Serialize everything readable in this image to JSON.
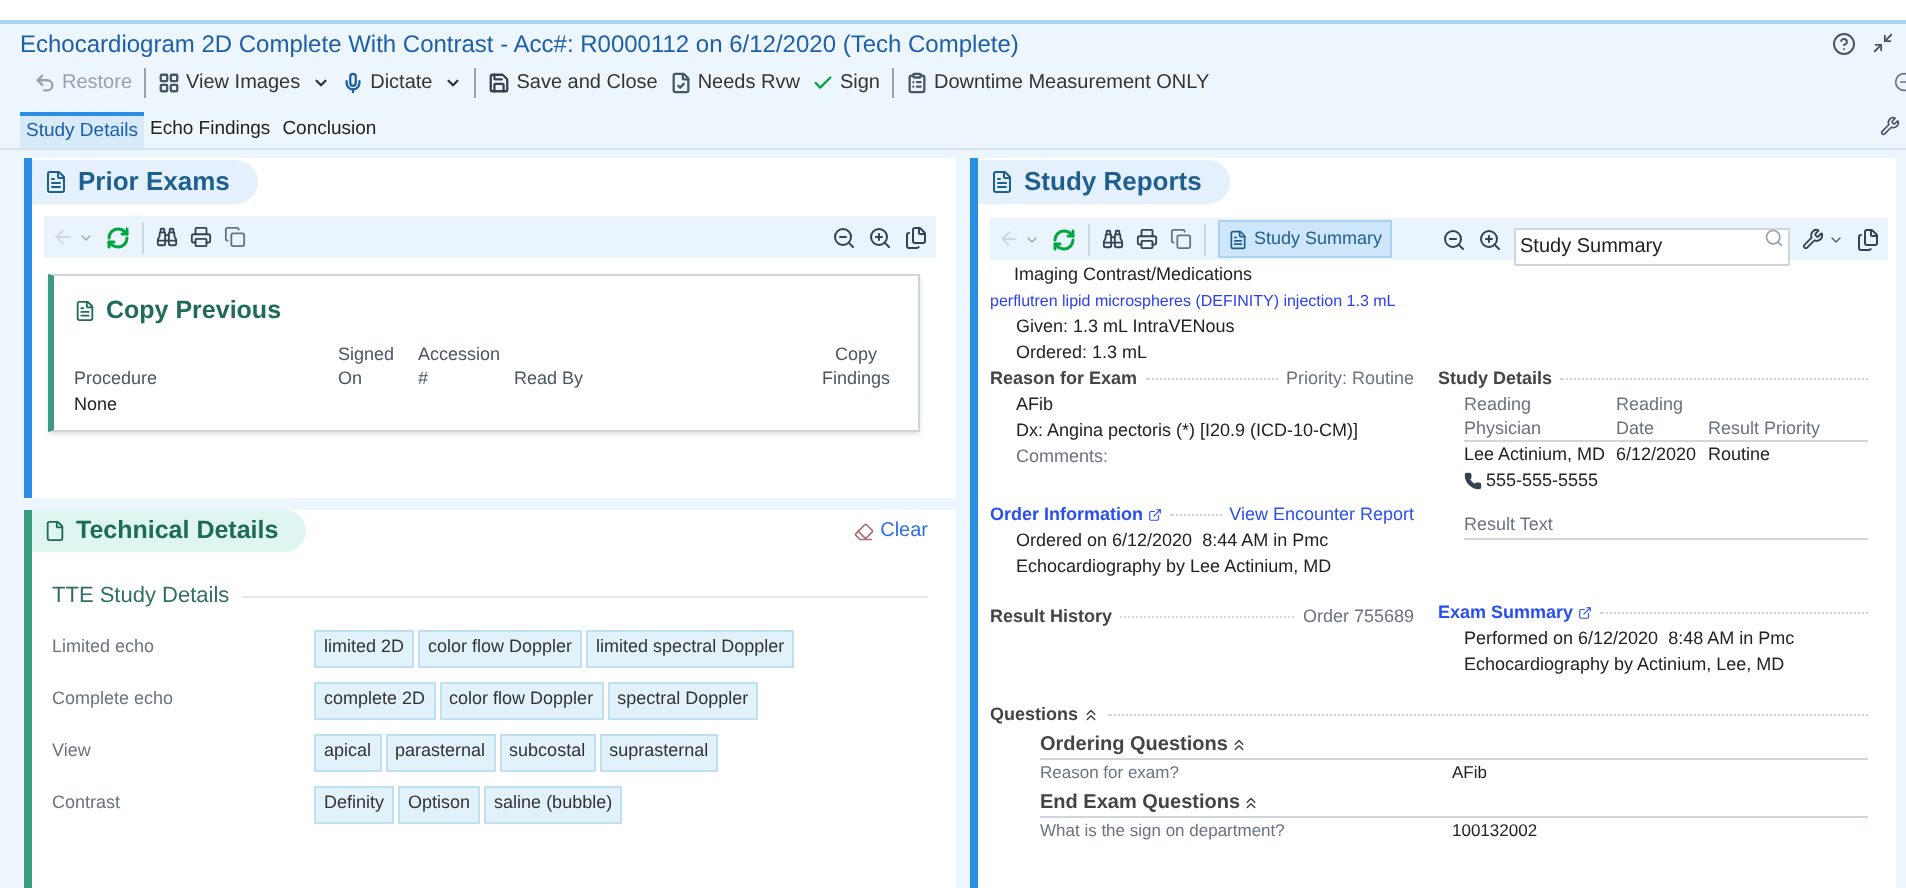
{
  "window": {
    "title": "Echocardiogram 2D Complete With Contrast - Acc#: R0000112 on 6/12/2020 (Tech Complete)"
  },
  "toolbar": [
    {
      "label": "Restore",
      "disabled": true,
      "dropdown": false,
      "separator_after": true
    },
    {
      "label": "View Images",
      "disabled": false,
      "dropdown": true,
      "separator_after": false
    },
    {
      "label": "Dictate",
      "disabled": false,
      "dropdown": true,
      "separator_after": true
    },
    {
      "label": "Save and Close",
      "disabled": false,
      "dropdown": false,
      "separator_after": false
    },
    {
      "label": "Needs Rvw",
      "disabled": false,
      "dropdown": false,
      "separator_after": false
    },
    {
      "label": "Sign",
      "disabled": false,
      "dropdown": false,
      "separator_after": true
    },
    {
      "label": "Downtime Measurement ONLY",
      "disabled": false,
      "dropdown": false,
      "separator_after": false
    }
  ],
  "tabs": [
    {
      "label": "Study Details",
      "selected": true
    },
    {
      "label": "Echo Findings",
      "selected": false
    },
    {
      "label": "Conclusion",
      "selected": false
    }
  ],
  "prior_exams": {
    "title": "Prior Exams",
    "copy_previous": {
      "title": "Copy Previous",
      "columns": [
        "Procedure",
        "Signed On",
        "Accession #",
        "Read By",
        "Copy Findings"
      ],
      "rows": [
        [
          "None"
        ]
      ]
    }
  },
  "technical_details": {
    "title": "Technical Details",
    "clear": "Clear",
    "section": "TTE Study Details",
    "rows": [
      {
        "label": "Limited echo",
        "options": [
          "limited 2D",
          "color flow Doppler",
          "limited spectral Doppler"
        ]
      },
      {
        "label": "Complete echo",
        "options": [
          "complete 2D",
          "color flow Doppler",
          "spectral Doppler"
        ]
      },
      {
        "label": "View",
        "options": [
          "apical",
          "parasternal",
          "subcostal",
          "suprasternal"
        ]
      },
      {
        "label": "Contrast",
        "options": [
          "Definity",
          "Optison",
          "saline (bubble)"
        ]
      }
    ]
  },
  "study_reports": {
    "title": "Study Reports",
    "summary_button": {
      "label": "Study Summary",
      "selected": true
    },
    "search": {
      "value": "Study Summary"
    },
    "medications": {
      "heading": "Imaging Contrast/Medications",
      "link": "perflutren lipid microspheres (DEFINITY) injection 1.3 mL",
      "lines": [
        "Given: 1.3 mL IntraVENous",
        "Ordered: 1.3 mL"
      ]
    },
    "reason": {
      "heading": "Reason for Exam",
      "priority": "Priority: Routine",
      "lines": [
        "AFib",
        "Dx: Angina pectoris (*) [I20.9 (ICD-10-CM)]"
      ],
      "comments": "Comments:"
    },
    "study_details": {
      "heading": "Study Details",
      "columns": [
        "Reading Physician",
        "Reading Date",
        "Result Priority"
      ],
      "row": [
        "Lee Actinium, MD",
        "6/12/2020",
        "Routine"
      ],
      "phone": "555-555-5555"
    },
    "order_information": {
      "heading": "Order Information",
      "link": "View Encounter Report",
      "lines": [
        "Ordered on 6/12/2020  8:44 AM in Pmc",
        "Echocardiography by Lee Actinium, MD"
      ]
    },
    "result_text": "Result Text",
    "result_history": {
      "heading": "Result History",
      "order": "Order 755689"
    },
    "exam_summary": {
      "heading": "Exam Summary",
      "lines": [
        "Performed on 6/12/2020  8:48 AM in Pmc",
        "Echocardiography by Actinium, Lee, MD"
      ]
    },
    "questions": {
      "heading": "Questions",
      "groups": [
        {
          "title": "Ordering Questions",
          "items": [
            {
              "question": "Reason for exam?",
              "answer": "AFib"
            }
          ]
        },
        {
          "title": "End Exam Questions",
          "items": [
            {
              "question": "What is the sign on department?",
              "answer": "100132002"
            }
          ]
        }
      ]
    }
  }
}
